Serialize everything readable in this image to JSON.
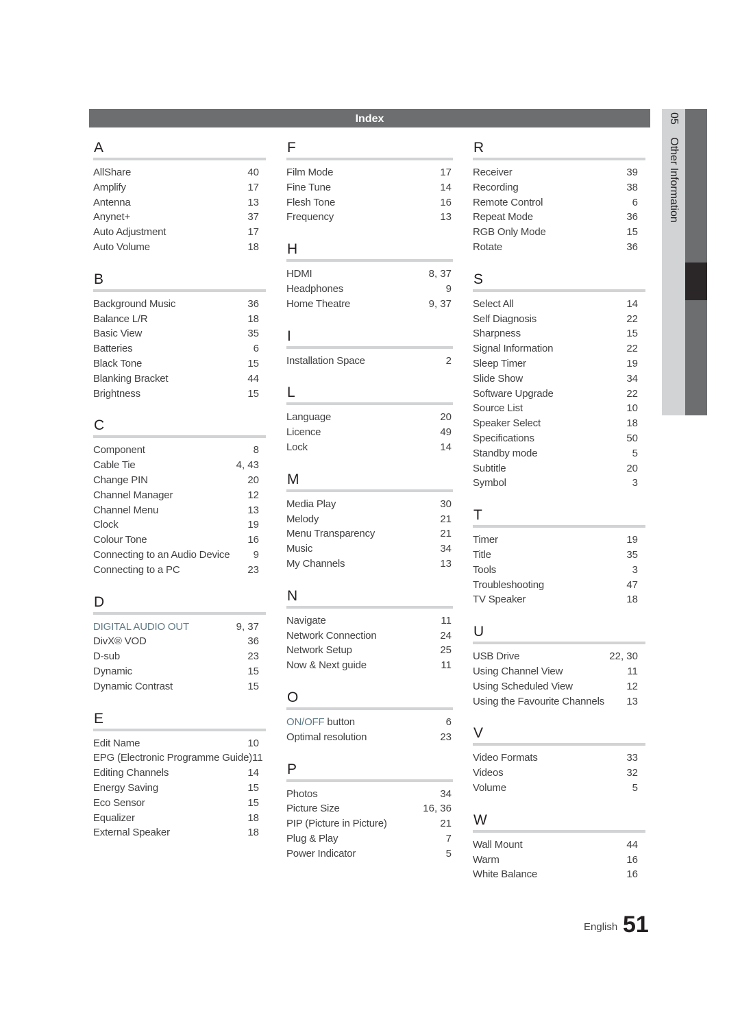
{
  "header": {
    "title": "Index"
  },
  "side_tab": {
    "chapter_number": "05",
    "chapter_title": "Other Information"
  },
  "footer": {
    "language": "English",
    "page_number": "51"
  },
  "colors": {
    "header_bar": "#6d6e70",
    "highlight_text": "#5e7b86",
    "rule": "#d1d3d4",
    "active_tab": "#2b2627"
  },
  "columns": [
    {
      "sections": [
        {
          "letter": "A",
          "entries": [
            {
              "term": "AllShare",
              "page": "40"
            },
            {
              "term": "Amplify",
              "page": "17"
            },
            {
              "term": "Antenna",
              "page": "13"
            },
            {
              "term": "Anynet+",
              "page": "37"
            },
            {
              "term": "Auto Adjustment",
              "page": "17"
            },
            {
              "term": "Auto Volume",
              "page": "18"
            }
          ]
        },
        {
          "letter": "B",
          "entries": [
            {
              "term": "Background Music",
              "page": "36"
            },
            {
              "term": "Balance  L/R",
              "page": "18"
            },
            {
              "term": "Basic View",
              "page": "35"
            },
            {
              "term": "Batteries",
              "page": "6"
            },
            {
              "term": "Black Tone",
              "page": "15"
            },
            {
              "term": "Blanking Bracket",
              "page": "44"
            },
            {
              "term": "Brightness",
              "page": "15"
            }
          ]
        },
        {
          "letter": "C",
          "entries": [
            {
              "term": "Component",
              "page": "8"
            },
            {
              "term": "Cable Tie",
              "page": "4, 43"
            },
            {
              "term": "Change PIN",
              "page": "20"
            },
            {
              "term": "Channel Manager",
              "page": "12"
            },
            {
              "term": "Channel Menu",
              "page": "13"
            },
            {
              "term": "Clock",
              "page": "19"
            },
            {
              "term": "Colour Tone",
              "page": "16"
            },
            {
              "term": "Connecting to an Audio Device",
              "page": "9"
            },
            {
              "term": "Connecting to a PC",
              "page": "23"
            }
          ]
        },
        {
          "letter": "D",
          "entries": [
            {
              "term": "DIGITAL AUDIO OUT",
              "page": "9, 37",
              "highlight": true
            },
            {
              "term": "DivX® VOD",
              "page": "36"
            },
            {
              "term": "D-sub",
              "page": "23"
            },
            {
              "term": "Dynamic",
              "page": "15"
            },
            {
              "term": "Dynamic Contrast",
              "page": "15"
            }
          ]
        },
        {
          "letter": "E",
          "entries": [
            {
              "term": "Edit Name",
              "page": "10"
            },
            {
              "term": "EPG (Electronic Programme Guide)",
              "page": "11"
            },
            {
              "term": "Editing Channels",
              "page": "14"
            },
            {
              "term": "Energy Saving",
              "page": "15"
            },
            {
              "term": "Eco Sensor",
              "page": "15"
            },
            {
              "term": "Equalizer",
              "page": "18"
            },
            {
              "term": "External Speaker",
              "page": "18"
            }
          ]
        }
      ]
    },
    {
      "sections": [
        {
          "letter": "F",
          "entries": [
            {
              "term": "Film Mode",
              "page": "17"
            },
            {
              "term": "Fine Tune",
              "page": "14"
            },
            {
              "term": "Flesh Tone",
              "page": "16"
            },
            {
              "term": "Frequency",
              "page": "13"
            }
          ]
        },
        {
          "letter": "H",
          "entries": [
            {
              "term": "HDMI",
              "page": "8, 37"
            },
            {
              "term": "Headphones",
              "page": "9"
            },
            {
              "term": "Home Theatre",
              "page": "9, 37"
            }
          ]
        },
        {
          "letter": "I",
          "entries": [
            {
              "term": "Installation Space",
              "page": "2"
            }
          ]
        },
        {
          "letter": "L",
          "entries": [
            {
              "term": "Language",
              "page": "20"
            },
            {
              "term": "Licence",
              "page": "49"
            },
            {
              "term": "Lock",
              "page": "14"
            }
          ]
        },
        {
          "letter": "M",
          "entries": [
            {
              "term": "Media Play",
              "page": "30"
            },
            {
              "term": "Melody",
              "page": "21"
            },
            {
              "term": "Menu Transparency",
              "page": "21"
            },
            {
              "term": "Music",
              "page": "34"
            },
            {
              "term": "My Channels",
              "page": "13"
            }
          ]
        },
        {
          "letter": "N",
          "entries": [
            {
              "term": "Navigate",
              "page": "11"
            },
            {
              "term": "Network Connection",
              "page": "24"
            },
            {
              "term": "Network Setup",
              "page": "25"
            },
            {
              "term": "Now & Next guide",
              "page": "11"
            }
          ]
        },
        {
          "letter": "O",
          "entries": [
            {
              "term": "ON/OFF",
              "term_suffix": " button",
              "page": "6",
              "partial_highlight": true
            },
            {
              "term": "Optimal resolution",
              "page": "23"
            }
          ]
        },
        {
          "letter": "P",
          "entries": [
            {
              "term": "Photos",
              "page": "34"
            },
            {
              "term": "Picture Size",
              "page": "16, 36"
            },
            {
              "term": "PIP (Picture in Picture)",
              "page": "21"
            },
            {
              "term": "Plug & Play",
              "page": "7"
            },
            {
              "term": "Power Indicator",
              "page": "5"
            }
          ]
        }
      ]
    },
    {
      "sections": [
        {
          "letter": "R",
          "entries": [
            {
              "term": "Receiver",
              "page": "39"
            },
            {
              "term": "Recording",
              "page": "38"
            },
            {
              "term": "Remote Control",
              "page": "6"
            },
            {
              "term": "Repeat Mode",
              "page": "36"
            },
            {
              "term": "RGB Only Mode",
              "page": "15"
            },
            {
              "term": "Rotate",
              "page": "36"
            }
          ]
        },
        {
          "letter": "S",
          "entries": [
            {
              "term": "Select All",
              "page": "14"
            },
            {
              "term": "Self Diagnosis",
              "page": "22"
            },
            {
              "term": "Sharpness",
              "page": "15"
            },
            {
              "term": "Signal Information",
              "page": "22"
            },
            {
              "term": "Sleep Timer",
              "page": "19"
            },
            {
              "term": "Slide Show",
              "page": "34"
            },
            {
              "term": "Software Upgrade",
              "page": "22"
            },
            {
              "term": "Source List",
              "page": "10"
            },
            {
              "term": "Speaker Select",
              "page": "18"
            },
            {
              "term": "Specifications",
              "page": "50"
            },
            {
              "term": "Standby mode",
              "page": "5"
            },
            {
              "term": "Subtitle",
              "page": "20"
            },
            {
              "term": "Symbol",
              "page": "3"
            }
          ]
        },
        {
          "letter": "T",
          "entries": [
            {
              "term": "Timer",
              "page": "19"
            },
            {
              "term": "Title",
              "page": "35"
            },
            {
              "term": "Tools",
              "page": "3"
            },
            {
              "term": "Troubleshooting",
              "page": "47"
            },
            {
              "term": "TV Speaker",
              "page": "18"
            }
          ]
        },
        {
          "letter": "U",
          "entries": [
            {
              "term": "USB Drive",
              "page": "22, 30"
            },
            {
              "term": "Using Channel View",
              "page": "11"
            },
            {
              "term": "Using Scheduled View",
              "page": "12"
            },
            {
              "term": "Using the Favourite Channels",
              "page": "13"
            }
          ]
        },
        {
          "letter": "V",
          "entries": [
            {
              "term": "Video Formats",
              "page": "33"
            },
            {
              "term": "Videos",
              "page": "32"
            },
            {
              "term": "Volume",
              "page": "5"
            }
          ]
        },
        {
          "letter": "W",
          "entries": [
            {
              "term": "Wall Mount",
              "page": "44"
            },
            {
              "term": "Warm",
              "page": "16"
            },
            {
              "term": "White Balance",
              "page": "16"
            }
          ]
        }
      ]
    }
  ]
}
